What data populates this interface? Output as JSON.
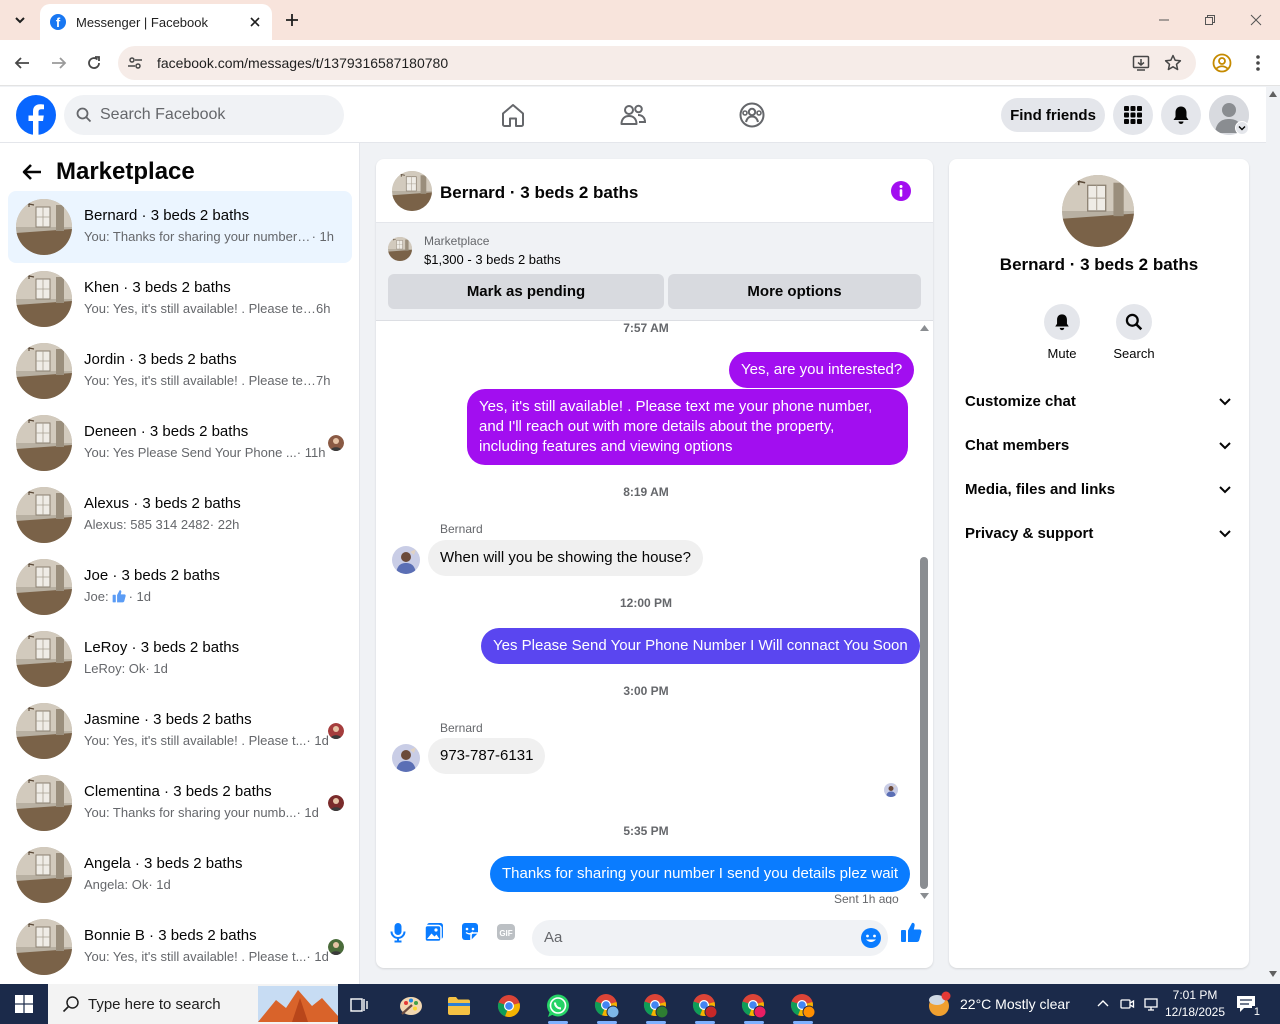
{
  "browser": {
    "tab_title": "Messenger | Facebook",
    "url": "facebook.com/messages/t/1379316587180780"
  },
  "fb": {
    "search_placeholder": "Search Facebook",
    "find_friends": "Find friends"
  },
  "sidebar": {
    "title": "Marketplace",
    "conversations": [
      {
        "name": "Bernard · 3 beds 2 baths",
        "snippet": "You: Thanks for sharing your number I...",
        "time": " · 1h",
        "active": true
      },
      {
        "name": "Khen · 3 beds 2 baths",
        "snippet": "You: Yes, it's still available! . Please tex...",
        "time": " 6h"
      },
      {
        "name": "Jordin · 3 beds 2 baths",
        "snippet": "You: Yes, it's still available! . Please tex...",
        "time": " 7h"
      },
      {
        "name": "Deneen · 3 beds 2 baths",
        "snippet": "You: Yes Please Send Your Phone ...",
        "time": " · 11h"
      },
      {
        "name": "Alexus · 3 beds 2 baths",
        "snippet": "Alexus: 585 314 2482",
        "time": " · 22h"
      },
      {
        "name": "Joe · 3 beds 2 baths",
        "snippet": "Joe:",
        "time": " · 1d"
      },
      {
        "name": "LeRoy · 3 beds 2 baths",
        "snippet": "LeRoy: Ok",
        "time": " · 1d"
      },
      {
        "name": "Jasmine · 3 beds 2 baths",
        "snippet": "You: Yes, it's still available! . Please t...",
        "time": " · 1d"
      },
      {
        "name": "Clementina · 3 beds 2 baths",
        "snippet": "You: Thanks for sharing your numb...",
        "time": " · 1d"
      },
      {
        "name": "Angela · 3 beds 2 baths",
        "snippet": "Angela: Ok",
        "time": " · 1d"
      },
      {
        "name": "Bonnie B · 3 beds 2 baths",
        "snippet": "You: Yes, it's still available! . Please t...",
        "time": " · 1d"
      }
    ]
  },
  "chat": {
    "title": "Bernard · 3 beds 2 baths",
    "marketplace_label": "Marketplace",
    "listing": "$1,300 - 3 beds 2 baths",
    "mark_pending": "Mark as pending",
    "more_options": "More options",
    "ts1": "7:57 AM",
    "msg1": "Yes, are you interested?",
    "msg2": "Yes, it's still available! . Please text me your phone number, and I'll reach out with more details about the property, including features and viewing options",
    "ts2": "8:19 AM",
    "sender": "Bernard",
    "msg3": "When will you be showing the house?",
    "ts3": "12:00 PM",
    "msg4": "Yes Please Send Your Phone Number I Will connact You Soon",
    "ts4": "3:00 PM",
    "msg5": "973-787-6131",
    "ts5": "5:35 PM",
    "msg6": "Thanks for sharing your number I send you details plez wait",
    "sent_status": "Sent 1h ago",
    "composer_placeholder": "Aa"
  },
  "details": {
    "name": "Bernard · 3 beds 2 baths",
    "mute": "Mute",
    "search": "Search",
    "rows": [
      "Customize chat",
      "Chat members",
      "Media, files and links",
      "Privacy & support"
    ]
  },
  "taskbar": {
    "search_placeholder": "Type here to search",
    "weather": "22°C  Mostly clear",
    "time": "7:01 PM",
    "date": "12/18/2025",
    "notif_count": "1"
  },
  "colors": {
    "fb_blue": "#1877f2",
    "bubble_purple": "#a20ef0",
    "bubble_blue": "#0a7cff",
    "bubble_indigo": "#5a46f0",
    "messenger_icon_purple": "#a20ef0"
  }
}
